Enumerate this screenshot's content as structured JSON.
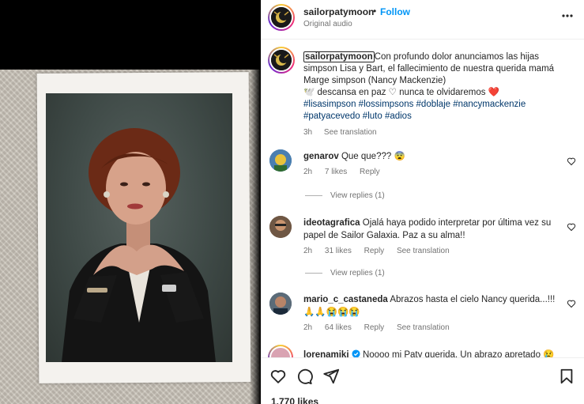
{
  "post": {
    "username": "sailorpatymoon",
    "dot": "•",
    "follow_label": "Follow",
    "audio": "Original audio"
  },
  "caption": {
    "username": "sailorpatymoon",
    "text_line1": "Con profundo dolor anunciamos las hijas",
    "text_line2": "simpson Lisa y Bart, el fallecimiento de nuestra querida mamá",
    "text_line3": "Marge simpson (Nancy Mackenzie)",
    "text_line4": "🕊️ descansa en paz ♡ nunca te olvidaremos ❤️",
    "tags_line1": "#lisasimpson #lossimpsons #doblaje #nancymackenzie",
    "tags_line2": "#patyacevedo #luto #adios",
    "time": "3h",
    "see_translation": "See translation"
  },
  "comments": [
    {
      "username": "genarov",
      "text": "Que que??? 😨",
      "time": "2h",
      "likes": "7 likes",
      "reply": "Reply",
      "translate": "",
      "view_replies": "View replies (1)"
    },
    {
      "username": "ideotagrafica",
      "text": "Ojalá haya podido interpretar por última vez su",
      "text2": "papel de Sailor Galaxia. Paz a su alma!!",
      "time": "2h",
      "likes": "31 likes",
      "reply": "Reply",
      "translate": "See translation",
      "view_replies": "View replies (1)"
    },
    {
      "username": "mario_c_castaneda",
      "text": "Abrazos hasta el cielo Nancy querida...!!!",
      "text2": "🙏🙏😭😭😭",
      "time": "2h",
      "likes": "64 likes",
      "reply": "Reply",
      "translate": "See translation"
    },
    {
      "username": "lorenamiki",
      "text": "Noooo mi Paty querida. Un abrazo apretado 😢"
    }
  ],
  "footer": {
    "likes": "1.770 likes"
  },
  "icons": {
    "more": "more-horizontal-icon",
    "heart": "heart-icon",
    "comment": "comment-icon",
    "share": "share-icon",
    "save": "bookmark-icon",
    "verified": "verified-badge-icon"
  },
  "colors": {
    "link": "#0095f6",
    "hashtag": "#00376b",
    "muted": "#737373",
    "heart_red": "#ed4956"
  }
}
